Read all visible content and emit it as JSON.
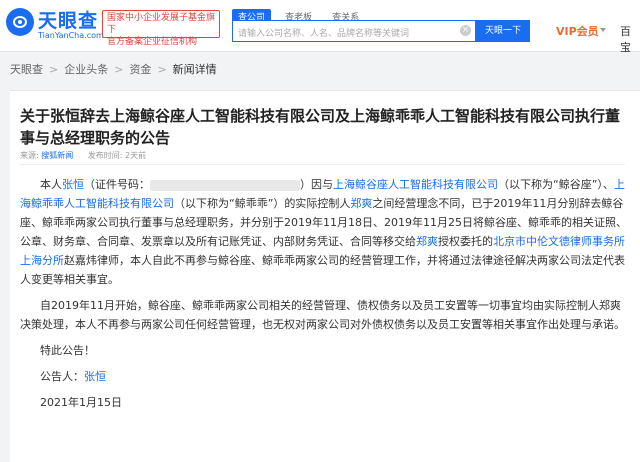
{
  "header": {
    "logo_cn": "天眼查",
    "logo_en": "TianYanCha.com",
    "badge_line1": "国家中小企业发展子基金旗下",
    "badge_line2": "官方备案企业征信机构",
    "tabs": [
      "查公司",
      "查老板",
      "查关系"
    ],
    "search_placeholder": "请输入公司名称、人名、品牌名称等关键词",
    "search_button": "天眼一下",
    "vip": "VIP会员",
    "more": "百宝"
  },
  "breadcrumb": {
    "items": [
      "天眼查",
      "企业头条",
      "资金",
      "新闻详情"
    ],
    "separator": ">"
  },
  "article": {
    "title": "关于张恒辞去上海鲸谷座人工智能科技有限公司及上海鲸乖乖人工智能科技有限公司执行董事与总经理职务的公告",
    "source_label": "来源:",
    "source": "搜狐新闻",
    "time_label": "发布时间:",
    "time": "2天前",
    "p1": {
      "t1": "本人",
      "name": "张恒",
      "t2": "（证件号码：",
      "t3": "）因与",
      "company1": "上海鲸谷座人工智能科技有限公司",
      "t4": "（以下称为“鲸谷座”）、",
      "company2": "上海鲸乖乖人工智能科技有限公司",
      "t5": "（以下称为“鲸乖乖”）的实际控制人",
      "controller": "郑爽",
      "t6": "之间经营理念不同，已于2019年11月分别辞去鲸谷座、鲸乖乖两家公司执行董事与总经理职务，并分别于2019年11月18日、2019年11月25日将鲸谷座、鲸乖乖的相关证照、公章、财务章、合同章、发票章以及所有记账凭证、内部财务凭证、合同等移交给",
      "controller2": "郑爽",
      "t7": "授权委托的",
      "lawfirm": "北京市中伦文德律师事务所上海分所",
      "t8": "赵嘉炜律师，本人自此不再参与鲸谷座、鲸乖乖两家公司的经营管理工作，并将通过法律途径解决两家公司法定代表人变更等相关事宜。"
    },
    "p2": "自2019年11月开始，鲸谷座、鲸乖乖两家公司相关的经营管理、债权债务以及员工安置等一切事宜均由实际控制人郑爽决策处理，本人不再参与两家公司任何经营管理，也无权对两家公司对外债权债务以及员工安置等相关事宜作出处理与承诺。",
    "p3": "特此公告！",
    "announcer_label": "公告人：",
    "announcer": "张恒",
    "date": "2021年1月15日"
  }
}
